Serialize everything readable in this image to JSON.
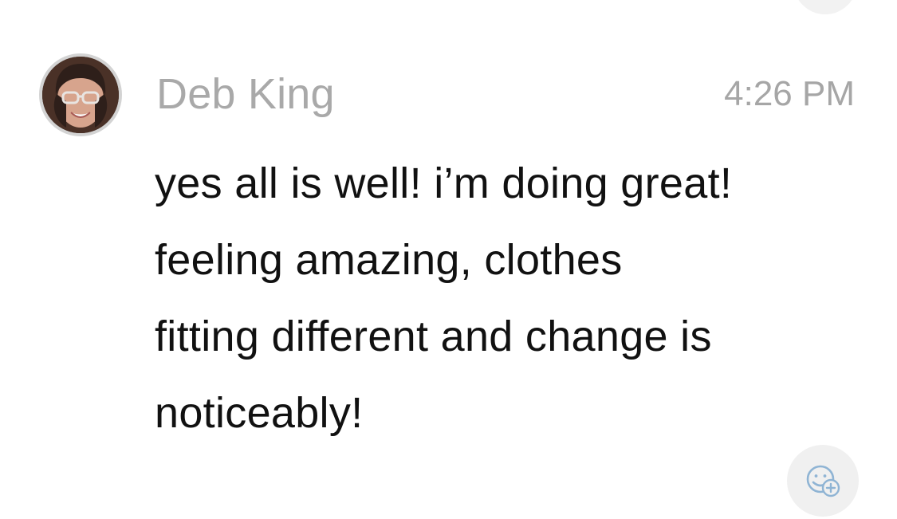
{
  "message": {
    "sender": "Deb King",
    "time": "4:26 PM",
    "lines": [
      "yes all is well! i’m doing great!",
      "feeling amazing, clothes",
      "fitting different and change is",
      "noticeably!"
    ]
  },
  "icons": {
    "avatar": "profile-photo",
    "reaction": "add-reaction-smiley-icon"
  },
  "colors": {
    "sender": "#a9a9a9",
    "timestamp": "#a6a6a6",
    "body_text": "#111111",
    "reaction_icon": "#8fb4d4",
    "avatar_border": "#d3d3d3"
  }
}
